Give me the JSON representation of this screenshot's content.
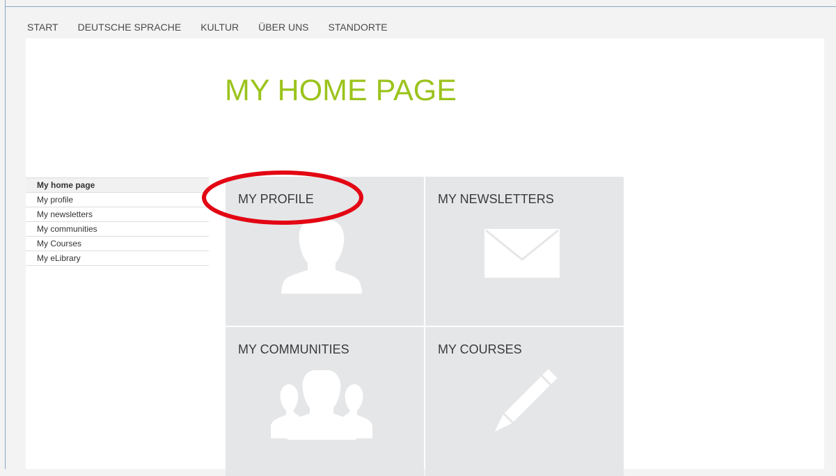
{
  "topnav": {
    "items": [
      "START",
      "DEUTSCHE SPRACHE",
      "KULTUR",
      "ÜBER UNS",
      "STANDORTE"
    ]
  },
  "page": {
    "title": "MY HOME PAGE"
  },
  "sidebar": {
    "items": [
      {
        "label": "My home page",
        "active": true
      },
      {
        "label": "My profile"
      },
      {
        "label": "My newsletters"
      },
      {
        "label": "My communities"
      },
      {
        "label": "My Courses"
      },
      {
        "label": "My eLibrary"
      }
    ]
  },
  "tiles": [
    {
      "title": "MY PROFILE",
      "icon": "person-icon"
    },
    {
      "title": "MY NEWSLETTERS",
      "icon": "envelope-icon"
    },
    {
      "title": "MY COMMUNITIES",
      "icon": "group-icon"
    },
    {
      "title": "MY COURSES",
      "icon": "pencil-icon"
    }
  ],
  "colors": {
    "title_green": "#9bc31c",
    "tile_bg": "#e5e6e8",
    "annotation_red": "#e30613"
  }
}
